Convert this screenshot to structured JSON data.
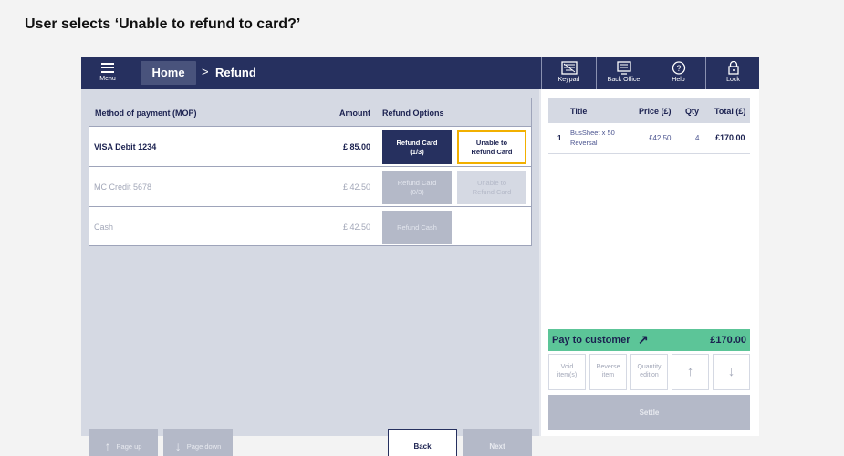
{
  "caption": "User selects ‘Unable to refund to card?’",
  "topbar": {
    "menu_label": "Menu",
    "home_label": "Home",
    "separator": ">",
    "current_page": "Refund",
    "tools": [
      {
        "label": "Keypad",
        "icon": "keypad-icon"
      },
      {
        "label": "Back Office",
        "icon": "monitor-icon"
      },
      {
        "label": "Help",
        "icon": "help-icon"
      },
      {
        "label": "Lock",
        "icon": "lock-icon"
      }
    ]
  },
  "mop_table": {
    "headers": {
      "method": "Method of payment (MOP)",
      "amount": "Amount",
      "options": "Refund Options"
    },
    "rows": [
      {
        "name": "VISA Debit 1234",
        "amount": "£ 85.00",
        "btn1_line1": "Refund Card",
        "btn1_line2": "(1/3)",
        "btn2_line1": "Unable to",
        "btn2_line2": "Refund Card"
      },
      {
        "name": "MC Credit 5678",
        "amount": "£ 42.50",
        "btn1_line1": "Refund Card",
        "btn1_line2": "(0/3)",
        "btn2_line1": "Unable to",
        "btn2_line2": "Refund Card"
      },
      {
        "name": "Cash",
        "amount": "£ 42.50",
        "btn1_line1": "Refund Cash"
      }
    ]
  },
  "footer": {
    "page_up": "Page up",
    "page_down": "Page down",
    "back": "Back",
    "next": "Next"
  },
  "basket": {
    "headers": {
      "title": "Title",
      "price": "Price (£)",
      "qty": "Qty",
      "total": "Total (£)"
    },
    "items": [
      {
        "index": "1",
        "title_line1": "BusSheet x 50",
        "title_line2": "Reversal",
        "price": "£42.50",
        "qty": "4",
        "total": "£170.00"
      }
    ],
    "pay_label": "Pay to customer",
    "pay_arrow": "↗",
    "pay_total": "£170.00",
    "actions": {
      "void_line1": "Void",
      "void_line2": "item(s)",
      "reverse_line1": "Reverse",
      "reverse_line2": "item",
      "qty_line1": "Quantity",
      "qty_line2": "edition",
      "up": "↑",
      "down": "↓"
    },
    "settle": "Settle"
  },
  "colors": {
    "navy": "#26305f",
    "highlight": "#f2b000",
    "pay_green": "#5cc598",
    "disabled": "#b4b9c8"
  }
}
